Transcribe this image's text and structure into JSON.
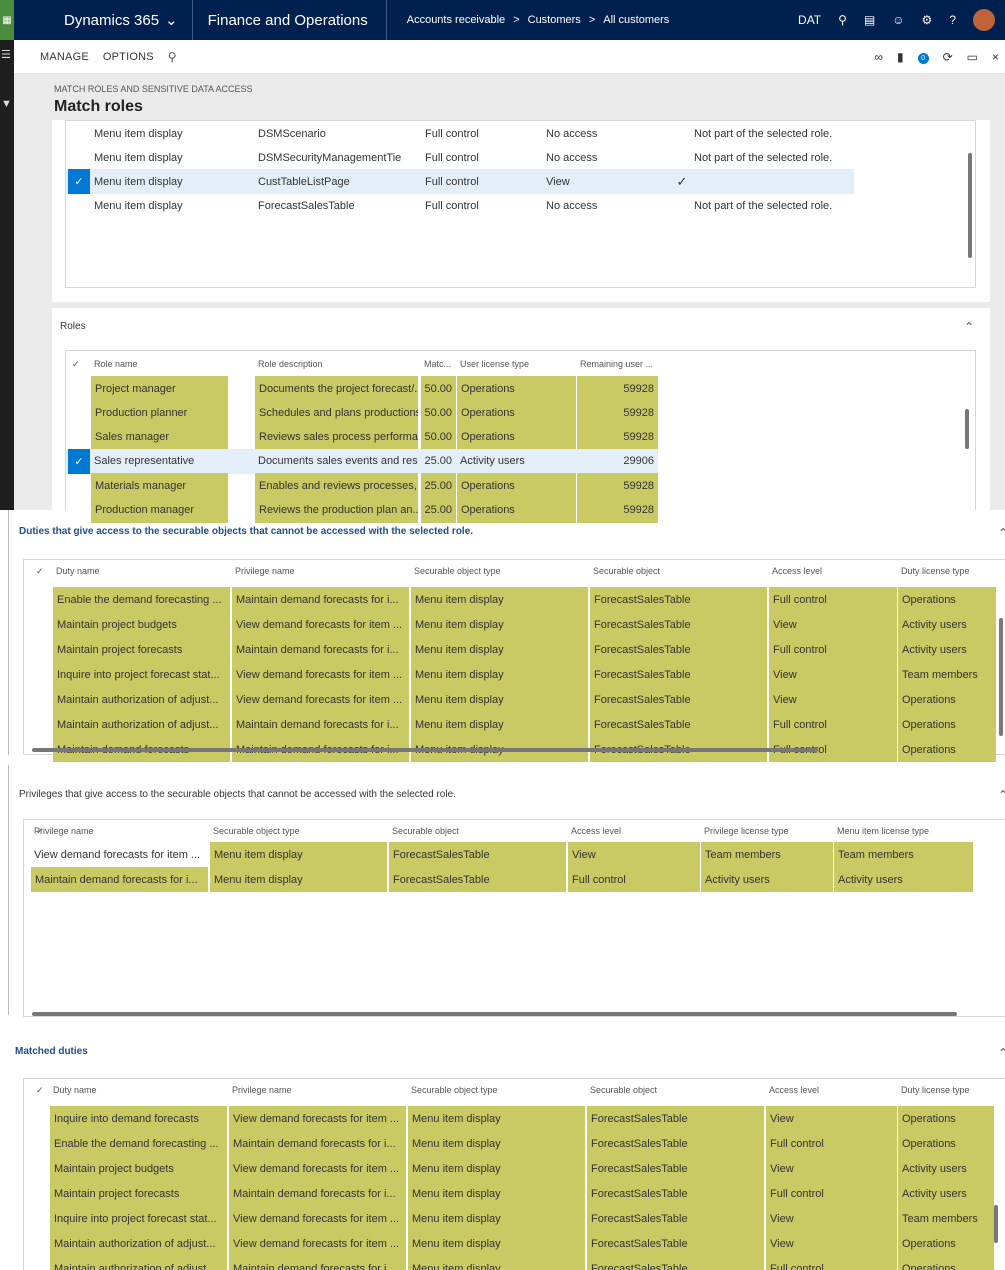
{
  "topbar": {
    "product": "Dynamics 365",
    "app": "Finance and Operations",
    "breadcrumb": [
      "Accounts receivable",
      "Customers",
      "All customers"
    ],
    "company": "DAT"
  },
  "actionbar": {
    "manage": "MANAGE",
    "options": "OPTIONS",
    "badge_count": "0"
  },
  "page": {
    "caption": "MATCH ROLES AND SENSITIVE DATA ACCESS",
    "title": "Match roles"
  },
  "top_grid": {
    "rows": [
      [
        "Menu item display",
        "DSMScenario",
        "Full control",
        "No access",
        "",
        "Not part of the selected role."
      ],
      [
        "Menu item display",
        "DSMSecurityManagementTie",
        "Full control",
        "No access",
        "",
        "Not part of the selected role."
      ],
      [
        "Menu item display",
        "CustTableListPage",
        "Full control",
        "View",
        "✓",
        ""
      ],
      [
        "Menu item display",
        "ForecastSalesTable",
        "Full control",
        "No access",
        "",
        "Not part of the selected role."
      ]
    ]
  },
  "roles": {
    "title": "Roles",
    "headers": [
      "Role name",
      "Role description",
      "Matc...",
      "User license type",
      "Remaining user ..."
    ],
    "rows": [
      [
        "Project manager",
        "Documents the project forecast/...",
        "50.00",
        "Operations",
        "59928"
      ],
      [
        "Production planner",
        "Schedules and plans productions",
        "50.00",
        "Operations",
        "59928"
      ],
      [
        "Sales manager",
        "Reviews sales process performa...",
        "50.00",
        "Operations",
        "59928"
      ],
      [
        "Sales representative",
        "Documents sales events and res...",
        "25.00",
        "Activity users",
        "29906"
      ],
      [
        "Materials manager",
        "Enables and reviews processes, ...",
        "25.00",
        "Operations",
        "59928"
      ],
      [
        "Production manager",
        "Reviews the production plan an...",
        "25.00",
        "Operations",
        "59928"
      ]
    ]
  },
  "duties": {
    "title": "Duties that give access to the securable objects that cannot be accessed with the selected role.",
    "headers": [
      "Duty name",
      "Privilege name",
      "Securable object type",
      "Securable object",
      "Access level",
      "Duty license type"
    ],
    "rows": [
      [
        "Enable the demand forecasting ...",
        "Maintain demand forecasts for i...",
        "Menu item display",
        "ForecastSalesTable",
        "Full control",
        "Operations"
      ],
      [
        "Maintain project budgets",
        "View demand forecasts for item ...",
        "Menu item display",
        "ForecastSalesTable",
        "View",
        "Activity users"
      ],
      [
        "Maintain project forecasts",
        "Maintain demand forecasts for i...",
        "Menu item display",
        "ForecastSalesTable",
        "Full control",
        "Activity users"
      ],
      [
        "Inquire into project forecast stat...",
        "View demand forecasts for item ...",
        "Menu item display",
        "ForecastSalesTable",
        "View",
        "Team members"
      ],
      [
        "Maintain authorization of adjust...",
        "View demand forecasts for item ...",
        "Menu item display",
        "ForecastSalesTable",
        "View",
        "Operations"
      ],
      [
        "Maintain authorization of adjust...",
        "Maintain demand forecasts for i...",
        "Menu item display",
        "ForecastSalesTable",
        "Full control",
        "Operations"
      ],
      [
        "Maintain demand forecasts",
        "Maintain demand forecasts for i...",
        "Menu item display",
        "ForecastSalesTable",
        "Full control",
        "Operations"
      ]
    ]
  },
  "privileges": {
    "title": "Privileges that give access to the securable objects that cannot be accessed with the selected role.",
    "headers": [
      "Privilege name",
      "Securable object type",
      "Securable object",
      "Access level",
      "Privilege license type",
      "Menu item license type"
    ],
    "rows": [
      [
        "View demand forecasts for item ...",
        "Menu item display",
        "ForecastSalesTable",
        "View",
        "Team members",
        "Team members"
      ],
      [
        "Maintain demand forecasts for i...",
        "Menu item display",
        "ForecastSalesTable",
        "Full control",
        "Activity users",
        "Activity users"
      ]
    ]
  },
  "matched": {
    "title": "Matched duties",
    "headers": [
      "Duty name",
      "Privilege name",
      "Securable object type",
      "Securable object",
      "Access level",
      "Duty license type"
    ],
    "rows": [
      [
        "Inquire into demand forecasts",
        "View demand forecasts for item ...",
        "Menu item display",
        "ForecastSalesTable",
        "View",
        "Operations"
      ],
      [
        "Enable the demand forecasting ...",
        "Maintain demand forecasts for i...",
        "Menu item display",
        "ForecastSalesTable",
        "Full control",
        "Operations"
      ],
      [
        "Maintain project budgets",
        "View demand forecasts for item ...",
        "Menu item display",
        "ForecastSalesTable",
        "View",
        "Activity users"
      ],
      [
        "Maintain project forecasts",
        "Maintain demand forecasts for i...",
        "Menu item display",
        "ForecastSalesTable",
        "Full control",
        "Activity users"
      ],
      [
        "Inquire into project forecast stat...",
        "View demand forecasts for item ...",
        "Menu item display",
        "ForecastSalesTable",
        "View",
        "Team members"
      ],
      [
        "Maintain authorization of adjust...",
        "View demand forecasts for item ...",
        "Menu item display",
        "ForecastSalesTable",
        "View",
        "Operations"
      ],
      [
        "Maintain authorization of adjust...",
        "Maintain demand forecasts for i...",
        "Menu item display",
        "ForecastSalesTable",
        "Full control",
        "Operations"
      ]
    ]
  }
}
